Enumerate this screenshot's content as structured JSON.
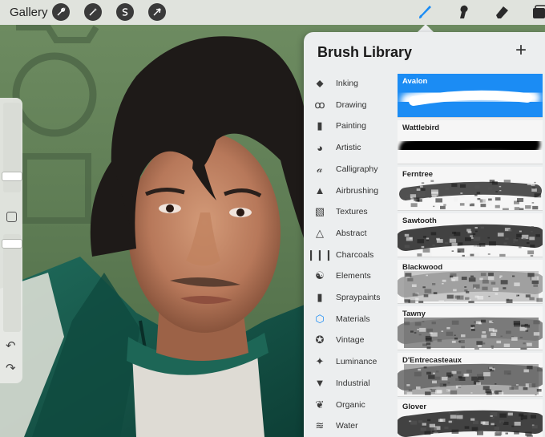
{
  "toolbar": {
    "gallery_label": "Gallery",
    "left_tools": [
      {
        "icon": "wrench-icon"
      },
      {
        "icon": "magic-wand-icon"
      },
      {
        "icon": "selection-s-icon"
      },
      {
        "icon": "arrow-cursor-icon"
      }
    ],
    "right_tools": [
      {
        "icon": "brush-icon",
        "active": true
      },
      {
        "icon": "smudge-icon"
      },
      {
        "icon": "eraser-icon"
      },
      {
        "icon": "layers-icon"
      }
    ],
    "accent_color": "#1b8cf4"
  },
  "sidebar": {
    "undo_icon": "↶",
    "redo_icon": "↷"
  },
  "brush_library": {
    "title": "Brush Library",
    "add_icon": "+",
    "categories": [
      {
        "label": "Inking",
        "icon": "ink-drop-icon",
        "glyph": "⬥"
      },
      {
        "label": "Drawing",
        "icon": "squiggle-icon",
        "glyph": "ꝏ"
      },
      {
        "label": "Painting",
        "icon": "paint-brush-icon",
        "glyph": "▮"
      },
      {
        "label": "Artistic",
        "icon": "palette-icon",
        "glyph": "◕"
      },
      {
        "label": "Calligraphy",
        "icon": "calligraphy-icon",
        "glyph": "𝒶"
      },
      {
        "label": "Airbrushing",
        "icon": "airbrush-icon",
        "glyph": "▲"
      },
      {
        "label": "Textures",
        "icon": "textures-icon",
        "glyph": "▧"
      },
      {
        "label": "Abstract",
        "icon": "triangle-icon",
        "glyph": "△"
      },
      {
        "label": "Charcoals",
        "icon": "charcoal-icon",
        "glyph": "❙❙❙"
      },
      {
        "label": "Elements",
        "icon": "yin-yang-icon",
        "glyph": "☯"
      },
      {
        "label": "Spraypaints",
        "icon": "spray-can-icon",
        "glyph": "▮"
      },
      {
        "label": "Materials",
        "icon": "cube-icon",
        "glyph": "⬡",
        "active": true
      },
      {
        "label": "Vintage",
        "icon": "star-icon",
        "glyph": "✪"
      },
      {
        "label": "Luminance",
        "icon": "sparkle-icon",
        "glyph": "✦"
      },
      {
        "label": "Industrial",
        "icon": "anvil-icon",
        "glyph": "▼"
      },
      {
        "label": "Organic",
        "icon": "leaf-icon",
        "glyph": "❦"
      },
      {
        "label": "Water",
        "icon": "waves-icon",
        "glyph": "≋"
      }
    ],
    "brushes": [
      {
        "name": "Avalon",
        "selected": true,
        "style": "glow"
      },
      {
        "name": "Wattlebird",
        "style": "solid"
      },
      {
        "name": "Ferntree",
        "style": "rough"
      },
      {
        "name": "Sawtooth",
        "style": "grain"
      },
      {
        "name": "Blackwood",
        "style": "wood"
      },
      {
        "name": "Tawny",
        "style": "speckle"
      },
      {
        "name": "D'Entrecasteaux",
        "style": "mottled"
      },
      {
        "name": "Glover",
        "style": "splatter"
      }
    ]
  }
}
